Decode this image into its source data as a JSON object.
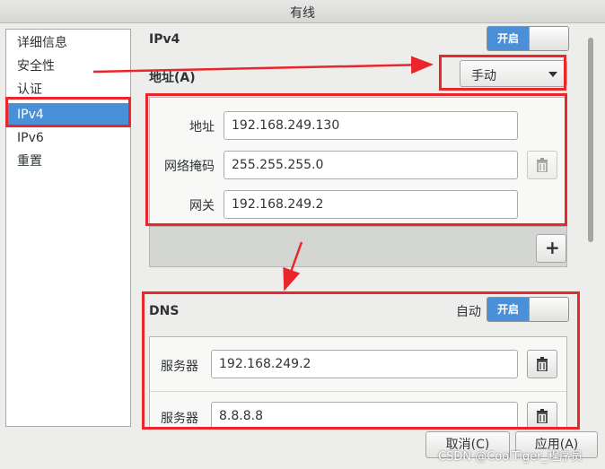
{
  "window": {
    "title": "有线"
  },
  "sidebar": {
    "items": [
      {
        "label": "详细信息"
      },
      {
        "label": "安全性"
      },
      {
        "label": "认证"
      },
      {
        "label": "IPv4"
      },
      {
        "label": "IPv6"
      },
      {
        "label": "重置"
      }
    ],
    "selected": "IPv4"
  },
  "ipv4": {
    "heading": "IPv4",
    "toggle_label": "开启",
    "toggle_on": true,
    "address_label": "地址(A)",
    "method_value": "手动",
    "fields": [
      {
        "label": "地址",
        "value": "192.168.249.130"
      },
      {
        "label": "网络掩码",
        "value": "255.255.255.0"
      },
      {
        "label": "网关",
        "value": "192.168.249.2"
      }
    ],
    "add_button": "+"
  },
  "dns": {
    "heading": "DNS",
    "auto_label": "自动",
    "toggle_label": "开启",
    "toggle_on": true,
    "servers": [
      {
        "label": "服务器",
        "value": "192.168.249.2"
      },
      {
        "label": "服务器",
        "value": "8.8.8.8"
      }
    ]
  },
  "footer": {
    "cancel_label": "取消(C)",
    "apply_label": "应用(A)"
  },
  "watermark": "CSDN @CoolTiger_程序员",
  "colors": {
    "accent": "#4a90d9",
    "annotation_red": "#e8262b"
  }
}
